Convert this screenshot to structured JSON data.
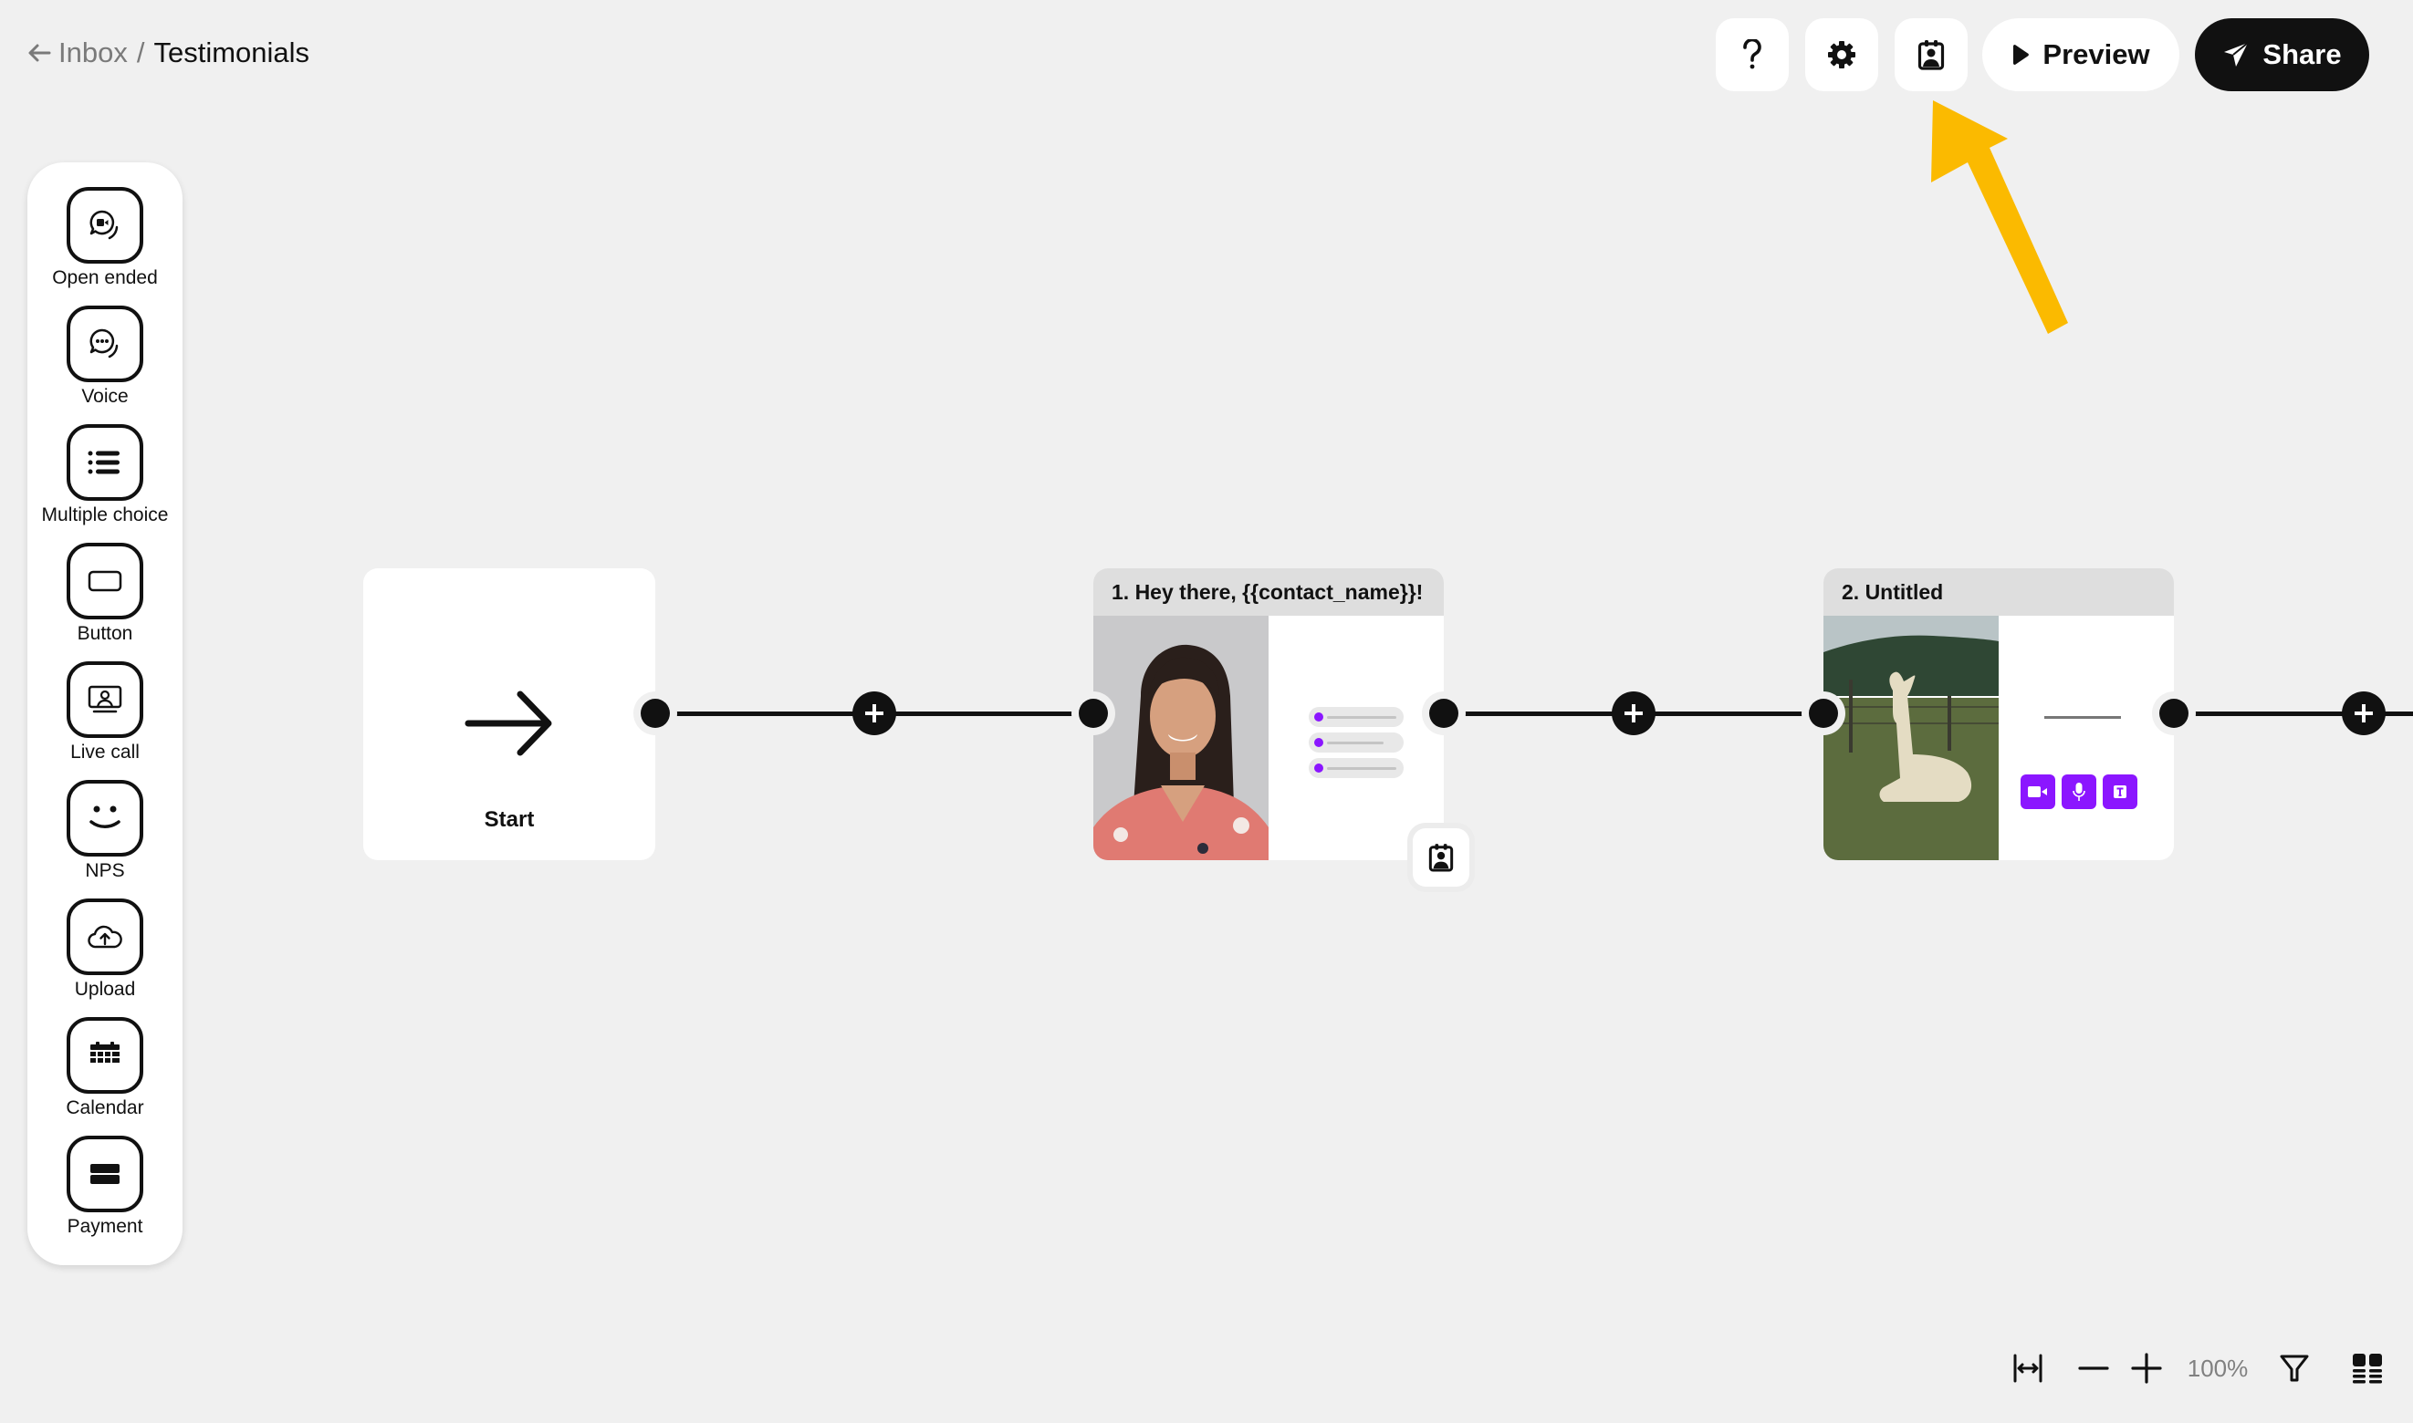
{
  "breadcrumb": {
    "back_icon": "arrow-left-icon",
    "parent": "Inbox",
    "separator": "/",
    "current": "Testimonials"
  },
  "toolbar": {
    "help_icon": "question-mark-icon",
    "settings_icon": "gear-icon",
    "contact_icon": "contact-card-icon",
    "preview_label": "Preview",
    "share_label": "Share"
  },
  "annotation": {
    "arrow_color": "#FBBA00",
    "points_to": "contact-card-button"
  },
  "sidebar": {
    "items": [
      {
        "label": "Open ended",
        "icon": "video-chat-bubble-icon"
      },
      {
        "label": "Voice",
        "icon": "voice-chat-bubble-icon"
      },
      {
        "label": "Multiple choice",
        "icon": "list-icon"
      },
      {
        "label": "Button",
        "icon": "button-rect-icon"
      },
      {
        "label": "Live call",
        "icon": "monitor-person-icon"
      },
      {
        "label": "NPS",
        "icon": "smiley-icon"
      },
      {
        "label": "Upload",
        "icon": "cloud-upload-icon"
      },
      {
        "label": "Calendar",
        "icon": "calendar-icon"
      },
      {
        "label": "Payment",
        "icon": "credit-card-icon"
      }
    ]
  },
  "flow": {
    "start": {
      "label": "Start",
      "icon": "arrow-right-icon"
    },
    "steps": [
      {
        "title": "1. Hey there, {{contact_name}}!",
        "media": "video thumbnail: smiling woman",
        "type": "multiple-choice",
        "options_count": 3,
        "badge_icon": "contact-card-icon"
      },
      {
        "title": "2. Untitled",
        "media": "video thumbnail: alpaca in field",
        "type": "open-ended",
        "response_types": [
          "video",
          "audio",
          "text"
        ]
      }
    ]
  },
  "colors": {
    "accent": "#8B16FF",
    "background": "#F0F0F0",
    "ink": "#111111",
    "annotation": "#FBBA00"
  },
  "bottom_controls": {
    "fit_icon": "fit-width-icon",
    "zoom_out_icon": "minus-icon",
    "zoom_in_icon": "plus-icon",
    "zoom_level": "100%",
    "filter_icon": "filter-icon",
    "layout_icon": "grid-layout-icon"
  }
}
